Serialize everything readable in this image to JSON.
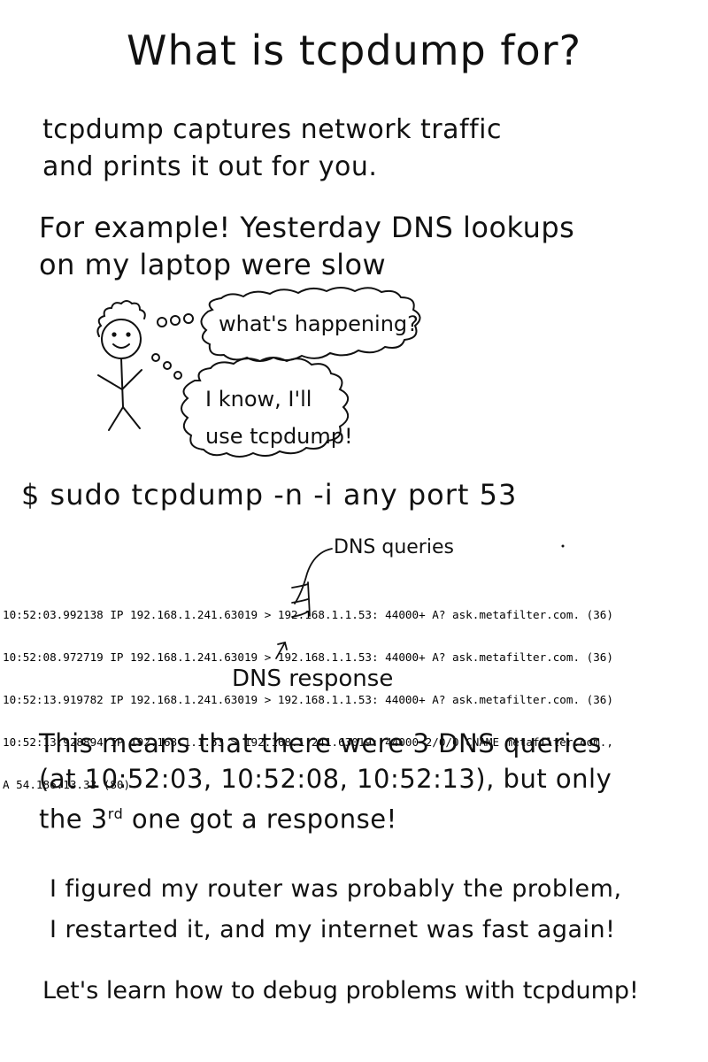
{
  "title": "What is tcpdump for?",
  "intro": {
    "line1": "tcpdump captures network traffic",
    "line2": "and prints it out for you."
  },
  "example": {
    "line1": "For example! Yesterday DNS lookups",
    "line2": "on my laptop were slow"
  },
  "thoughts": {
    "bubble1": "what's happening?",
    "bubble2_line1": "I know, I'll",
    "bubble2_line2": "use tcpdump!"
  },
  "command": "$ sudo tcpdump -n -i any port 53",
  "output_lines": [
    "10:52:03.992138 IP 192.168.1.241.63019 > 192.168.1.1.53: 44000+ A? ask.metafilter.com. (36)",
    "10:52:08.972719 IP 192.168.1.241.63019 > 192.168.1.1.53: 44000+ A? ask.metafilter.com. (36)",
    "10:52:13.919782 IP 192.168.1.241.63019 > 192.168.1.1.53: 44000+ A? ask.metafilter.com. (36)",
    "10:52:13.928894 IP 192.168.1.1.53 > 192.168.1.241.63019: 44000 2/0/0 CNAME metafilter.com.,",
    "A 54.186.13.33 (80)"
  ],
  "annotations": {
    "queries": "DNS queries",
    "response": "DNS response"
  },
  "meaning": {
    "line1": "This means that there were 3 DNS queries",
    "line2": "(at 10:52:03, 10:52:08, 10:52:13), but only",
    "line3_pre": "the 3",
    "line3_sup": "rd",
    "line3_post": " one got a response!"
  },
  "conclusion": {
    "line1": "I figured my router was probably the problem,",
    "line2": "I restarted it, and my internet was fast again!"
  },
  "closing": "Let's learn how to debug problems with tcpdump!"
}
